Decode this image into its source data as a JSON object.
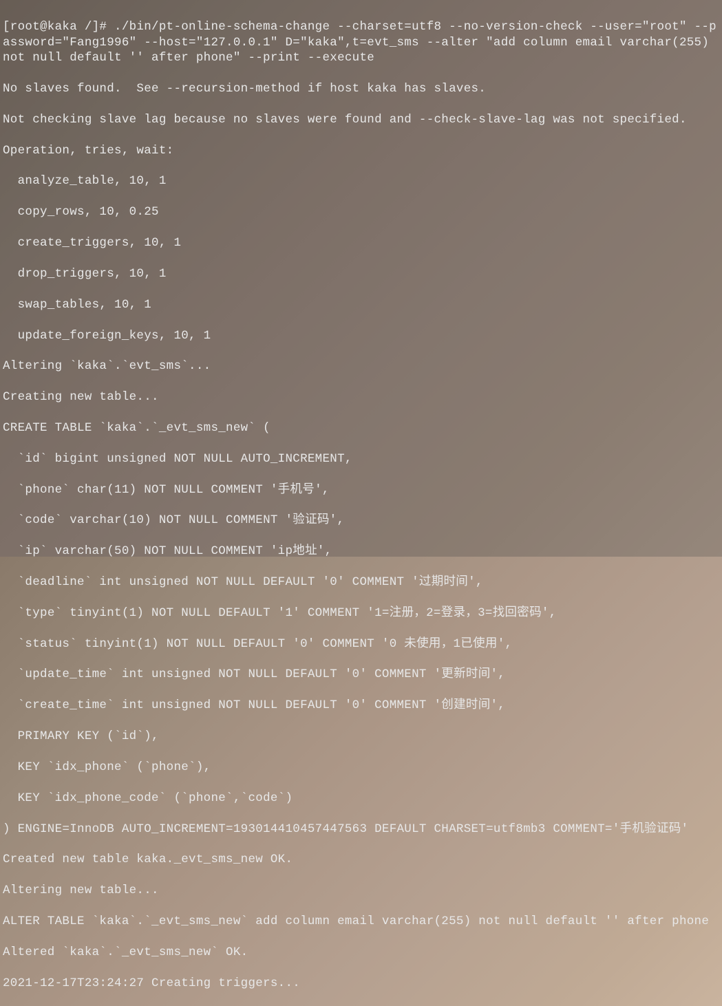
{
  "terminal": {
    "lines": [
      "[root@kaka /]# ./bin/pt-online-schema-change --charset=utf8 --no-version-check --user=\"root\" --password=\"Fang1996\" --host=\"127.0.0.1\" D=\"kaka\",t=evt_sms --alter \"add column email varchar(255) not null default '' after phone\" --print --execute",
      "No slaves found.  See --recursion-method if host kaka has slaves.",
      "Not checking slave lag because no slaves were found and --check-slave-lag was not specified.",
      "Operation, tries, wait:",
      "  analyze_table, 10, 1",
      "  copy_rows, 10, 0.25",
      "  create_triggers, 10, 1",
      "  drop_triggers, 10, 1",
      "  swap_tables, 10, 1",
      "  update_foreign_keys, 10, 1",
      "Altering `kaka`.`evt_sms`...",
      "Creating new table...",
      "CREATE TABLE `kaka`.`_evt_sms_new` (",
      "  `id` bigint unsigned NOT NULL AUTO_INCREMENT,",
      "  `phone` char(11) NOT NULL COMMENT '手机号',",
      "  `code` varchar(10) NOT NULL COMMENT '验证码',",
      "  `ip` varchar(50) NOT NULL COMMENT 'ip地址',",
      "  `deadline` int unsigned NOT NULL DEFAULT '0' COMMENT '过期时间',",
      "  `type` tinyint(1) NOT NULL DEFAULT '1' COMMENT '1=注册，2=登录，3=找回密码',",
      "  `status` tinyint(1) NOT NULL DEFAULT '0' COMMENT '0 未使用，1已使用',",
      "  `update_time` int unsigned NOT NULL DEFAULT '0' COMMENT '更新时间',",
      "  `create_time` int unsigned NOT NULL DEFAULT '0' COMMENT '创建时间',",
      "  PRIMARY KEY (`id`),",
      "  KEY `idx_phone` (`phone`),",
      "  KEY `idx_phone_code` (`phone`,`code`)",
      ") ENGINE=InnoDB AUTO_INCREMENT=193014410457447563 DEFAULT CHARSET=utf8mb3 COMMENT='手机验证码'",
      "Created new table kaka._evt_sms_new OK.",
      "Altering new table...",
      "ALTER TABLE `kaka`.`_evt_sms_new` add column email varchar(255) not null default '' after phone",
      "Altered `kaka`.`_evt_sms_new` OK.",
      "2021-12-17T23:24:27 Creating triggers..."
    ]
  }
}
